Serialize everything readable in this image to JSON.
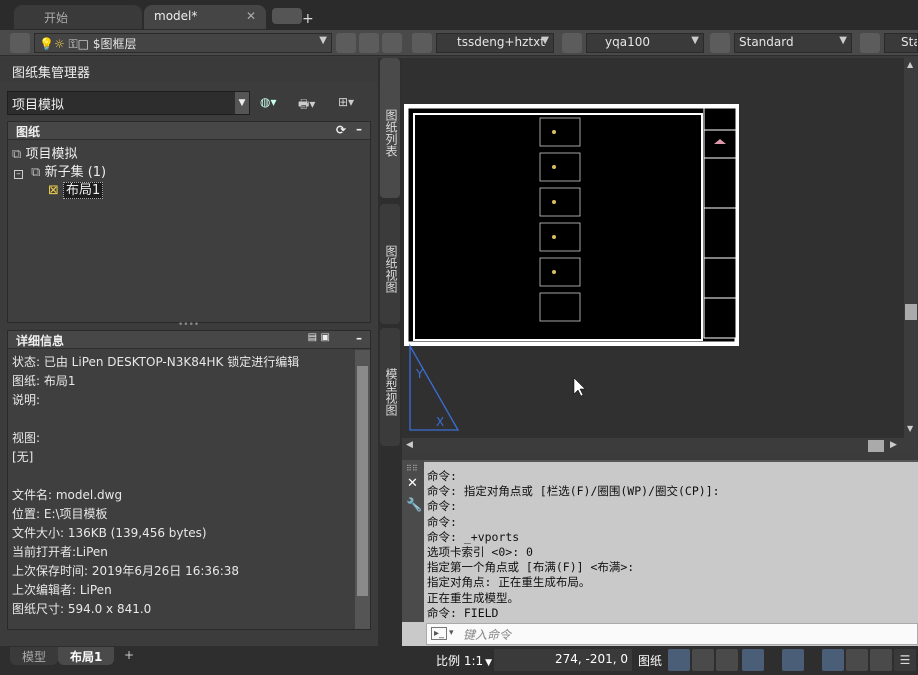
{
  "tabs": {
    "start": "开始",
    "model": "model*",
    "close": "✕",
    "add": "+"
  },
  "toolbar": {
    "layer": "$图框层",
    "textstyle": "tssdeng+hztxt",
    "dimstyle": "yqa100",
    "tablestyle": "Standard",
    "mleader": "Sta"
  },
  "ssm": {
    "title": "图纸集管理器",
    "current_set": "项目模拟",
    "sheets": {
      "header": "图纸",
      "root": "项目模拟",
      "subset": "新子集 (1)",
      "sheet": "布局1"
    },
    "details": {
      "header": "详细信息",
      "lines": [
        "状态: 已由 LiPen DESKTOP-N3K84HK 锁定进行编辑",
        "图纸: 布局1",
        "说明:",
        "",
        "视图:",
        "[无]",
        "",
        "文件名: model.dwg",
        "位置: E:\\项目模板",
        "文件大小: 136KB (139,456 bytes)",
        "当前打开者:LiPen",
        "上次保存时间: 2019年6月26日  16:36:38",
        "上次编辑者: LiPen",
        "图纸尺寸: 594.0 x 841.0"
      ]
    },
    "side_tabs": [
      "图纸列表",
      "图纸视图",
      "模型视图"
    ]
  },
  "command": {
    "history": [
      "命令:",
      "命令: 指定对角点或 [栏选(F)/圈围(WP)/圈交(CP)]:",
      "命令:",
      "命令:",
      "命令: _+vports",
      "选项卡索引 <0>: 0",
      "指定第一个角点或 [布满(F)] <布满>:",
      "指定对角点: 正在重生成布局。",
      "正在重生成模型。",
      "命令: FIELD"
    ],
    "placeholder": "键入命令"
  },
  "status": {
    "model_tab": "模型",
    "layout_tab": "布局1",
    "add": "+",
    "scale": "比例 1:1",
    "coords": "274, -201, 0",
    "paper": "图纸"
  }
}
